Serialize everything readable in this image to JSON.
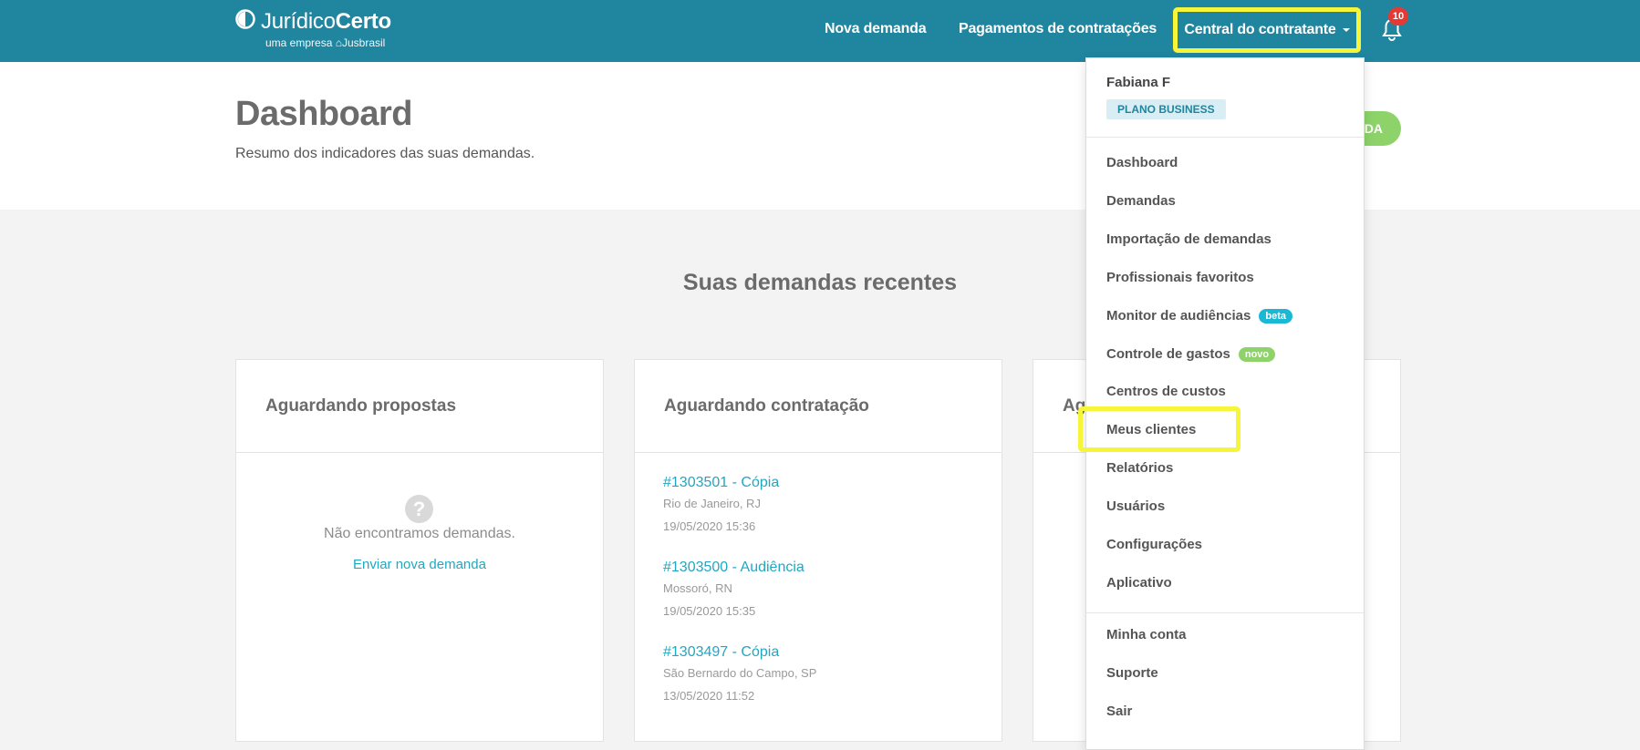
{
  "brand": {
    "name_regular": "Jurídico",
    "name_bold": "Certo",
    "tagline": "uma empresa",
    "parent": "Jusbrasil",
    "accent_color": "#20859f"
  },
  "nav": {
    "new_demand": "Nova demanda",
    "payments": "Pagamentos de contratações",
    "central": "Central do contratante",
    "notifications_count": "10"
  },
  "page": {
    "title": "Dashboard",
    "subtitle": "Resumo dos indicadores das suas demandas.",
    "new_button_visible_text": "DA"
  },
  "recent": {
    "title": "Suas demandas recentes",
    "cards": [
      {
        "title": "Aguardando propostas",
        "empty_text": "Não encontramos demandas.",
        "empty_link": "Enviar nova demanda",
        "icon": "question-icon"
      },
      {
        "title": "Aguardando contratação",
        "items": [
          {
            "title": "#1303501 - Cópia",
            "location": "Rio de Janeiro, RJ",
            "date": "19/05/2020 15:36"
          },
          {
            "title": "#1303500 - Audiência",
            "location": "Mossoró, RN",
            "date": "19/05/2020 15:35"
          },
          {
            "title": "#1303497 - Cópia",
            "location": "São Bernardo do Campo, SP",
            "date": "13/05/2020 11:52"
          }
        ]
      },
      {
        "title": "Ag"
      }
    ]
  },
  "dropdown": {
    "user_name": "Fabiana F",
    "plan": "PLANO BUSINESS",
    "items": [
      {
        "label": "Dashboard"
      },
      {
        "label": "Demandas"
      },
      {
        "label": "Importação de demandas"
      },
      {
        "label": "Profissionais favoritos"
      },
      {
        "label": "Monitor de audiências",
        "tag": "beta"
      },
      {
        "label": "Controle de gastos",
        "tag": "novo"
      },
      {
        "label": "Centros de custos"
      },
      {
        "label": "Meus clientes"
      },
      {
        "label": "Relatórios"
      },
      {
        "label": "Usuários"
      },
      {
        "label": "Configurações"
      },
      {
        "label": "Aplicativo"
      }
    ],
    "account_items": [
      {
        "label": "Minha conta"
      },
      {
        "label": "Suporte"
      },
      {
        "label": "Sair"
      }
    ]
  },
  "highlight_color": "#f6f53a"
}
